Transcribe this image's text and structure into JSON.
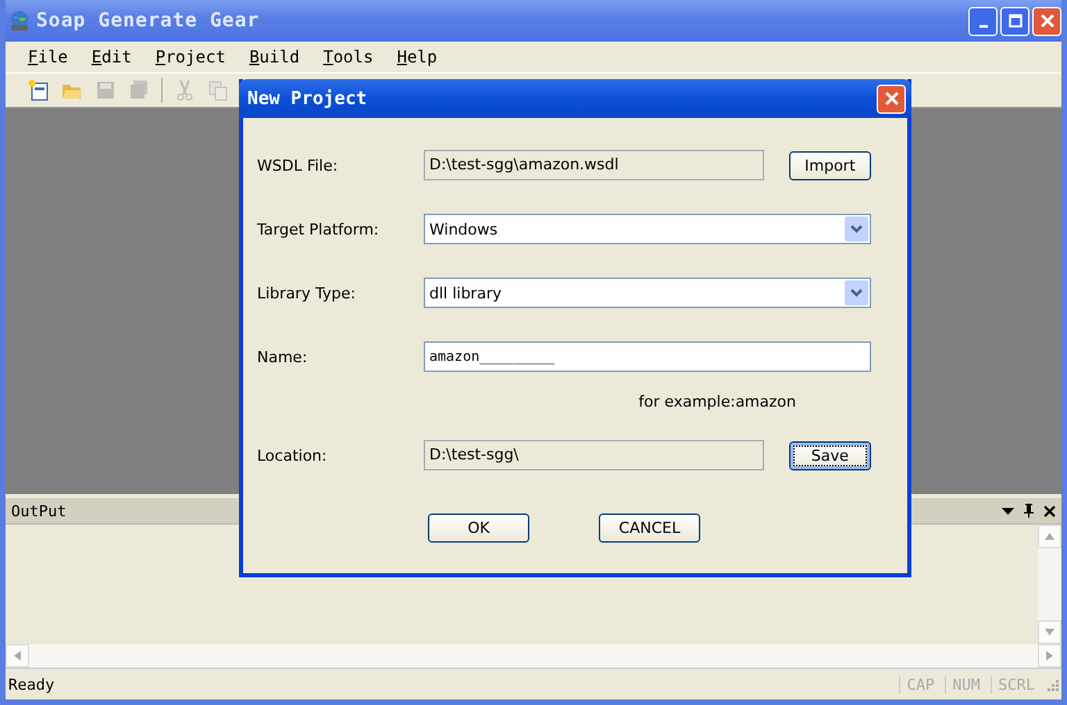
{
  "window": {
    "title": "Soap Generate Gear"
  },
  "menu": [
    {
      "label": "File"
    },
    {
      "label": "Edit"
    },
    {
      "label": "Project"
    },
    {
      "label": "Build"
    },
    {
      "label": "Tools"
    },
    {
      "label": "Help"
    }
  ],
  "toolbar": [
    {
      "kind": "new",
      "disabled": false
    },
    {
      "kind": "open",
      "disabled": false
    },
    {
      "kind": "save",
      "disabled": true
    },
    {
      "kind": "saveall",
      "disabled": true
    },
    {
      "kind": "cut",
      "disabled": true
    },
    {
      "kind": "copy",
      "disabled": true
    }
  ],
  "output_pane": {
    "title": "OutPut"
  },
  "status_bar": {
    "text": "Ready",
    "indicators": [
      {
        "label": "CAP",
        "disabled": true
      },
      {
        "label": "NUM",
        "disabled": true
      },
      {
        "label": "SCRL",
        "disabled": true
      }
    ]
  },
  "dialog": {
    "title": "New Project",
    "rows": [
      {
        "kind": "readonly",
        "label": "WSDL File:",
        "value": "D:\\test-sgg\\amazon.wsdl",
        "button": {
          "label": "Import",
          "focused": false
        }
      },
      {
        "kind": "dropdown",
        "label": "Target Platform:",
        "value": "Windows"
      },
      {
        "kind": "dropdown",
        "label": "Library Type:",
        "value": "dll library"
      },
      {
        "kind": "text",
        "label": "Name:",
        "value": "amazon_________",
        "hint": "for example:amazon"
      },
      {
        "kind": "readonly",
        "label": "Location:",
        "value": "D:\\test-sgg\\",
        "button": {
          "label": "Save",
          "focused": true
        }
      }
    ],
    "buttons": [
      {
        "label": "OK"
      },
      {
        "label": "CANCEL"
      }
    ]
  }
}
